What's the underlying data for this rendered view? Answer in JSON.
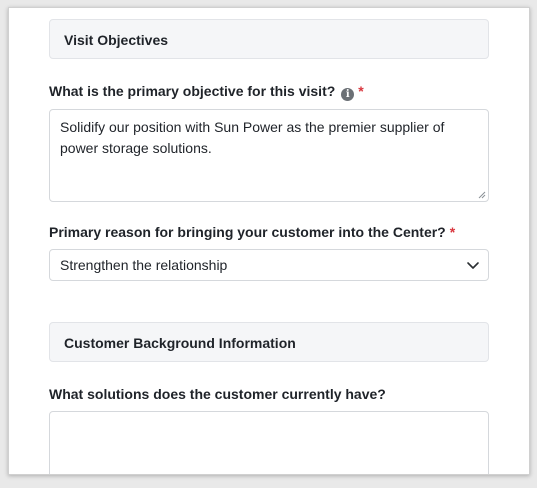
{
  "sections": {
    "visit_objectives": "Visit Objectives",
    "customer_background": "Customer Background Information"
  },
  "questions": {
    "primary_objective": {
      "label": "What is the primary objective for this visit?",
      "required_mark": "*",
      "info_icon": "i",
      "value": "Solidify our position with Sun Power as the premier supplier of power storage solutions."
    },
    "primary_reason": {
      "label": "Primary reason for bringing your customer into the Center?",
      "required_mark": "*",
      "selected": "Strengthen the relationship"
    },
    "current_solutions": {
      "label": "What solutions does the customer currently have?",
      "value": ""
    }
  },
  "icons": {
    "info": "info-circle-icon",
    "dropdown": "chevron-down-icon",
    "resize": "resize-grip-icon"
  },
  "colors": {
    "required": "#d9363e",
    "section_bg": "#f5f6f8",
    "border": "#d5d8dc"
  }
}
